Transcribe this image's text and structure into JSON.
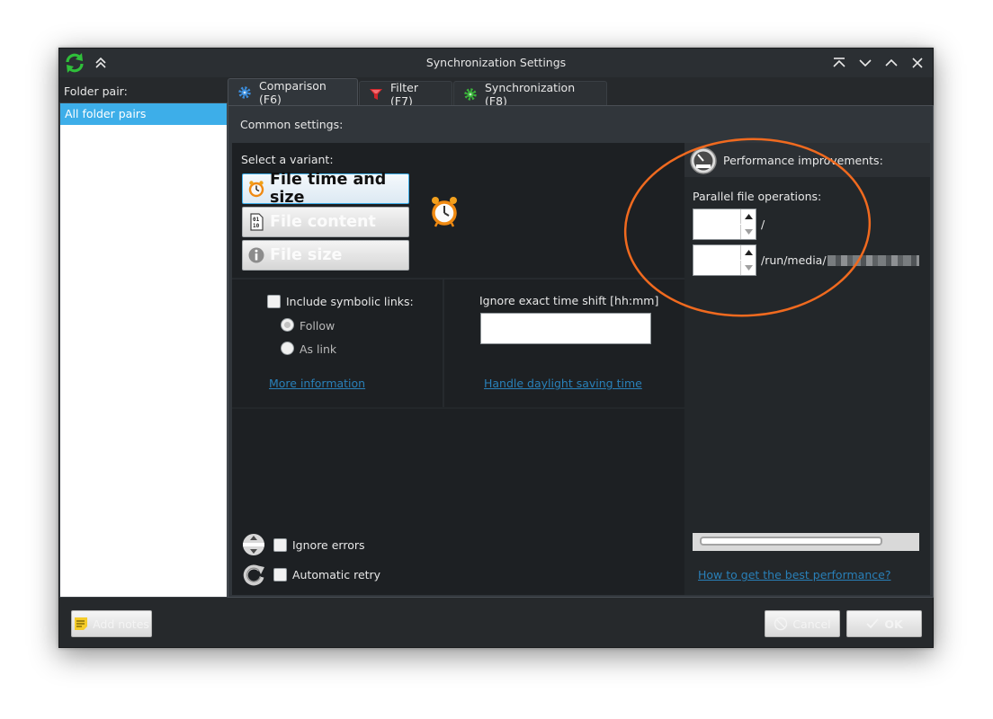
{
  "window": {
    "title": "Synchronization Settings"
  },
  "left": {
    "label": "Folder pair:",
    "items": [
      {
        "label": "All folder pairs"
      }
    ]
  },
  "tabs": [
    {
      "label": "Comparison (F6)"
    },
    {
      "label": "Filter (F7)"
    },
    {
      "label": "Synchronization (F8)"
    }
  ],
  "comparison": {
    "common_label": "Common settings:",
    "variant_label": "Select a variant:",
    "variants": [
      {
        "label": "File time and size",
        "icon": "clock-icon"
      },
      {
        "label": "File content",
        "icon": "binary-file-icon"
      },
      {
        "label": "File size",
        "icon": "info-icon"
      }
    ],
    "symlinks": {
      "label": "Include symbolic links:",
      "follow": "Follow",
      "as_link": "As link",
      "more_info": "More information"
    },
    "timeshift": {
      "label": "Ignore exact time shift [hh:mm]",
      "value": "",
      "dst_link": "Handle daylight saving time"
    },
    "errors": {
      "ignore_label": "Ignore errors",
      "retry_label": "Automatic retry"
    }
  },
  "performance": {
    "title": "Performance improvements:",
    "parallel_label": "Parallel file operations:",
    "rows": [
      {
        "value": "",
        "path": "/"
      },
      {
        "value": "",
        "path": "/run/media/"
      }
    ],
    "best_link": "How to get the best performance?"
  },
  "footer": {
    "notes_label": "Add notes",
    "cancel_label": "Cancel",
    "ok_label": "OK"
  },
  "colors": {
    "accent": "#3daee9",
    "link": "#2980b9",
    "annotation": "#f06a1f",
    "window_bg": "#26292c"
  }
}
